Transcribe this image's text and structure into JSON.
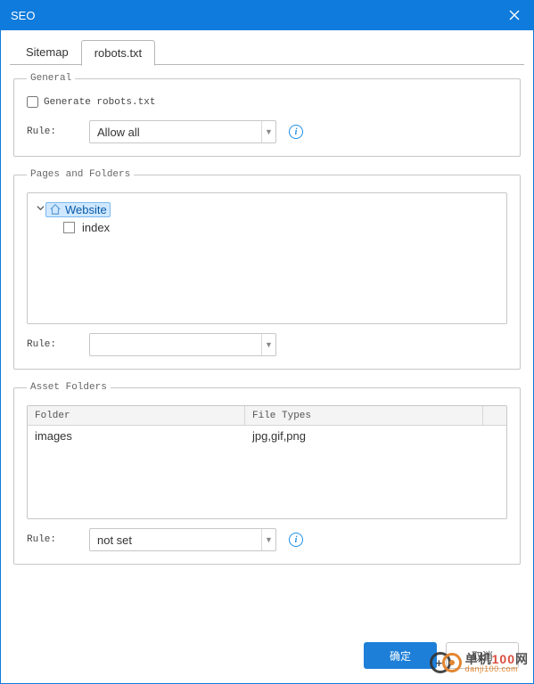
{
  "window": {
    "title": "SEO"
  },
  "tabs": {
    "sitemap": "Sitemap",
    "robots": "robots.txt"
  },
  "general": {
    "legend": "General",
    "generate_label": "Generate robots.txt",
    "generate_checked": false,
    "rule_label": "Rule:",
    "rule_value": "Allow all"
  },
  "pages": {
    "legend": "Pages and Folders",
    "tree": {
      "root": "Website",
      "child": "index"
    },
    "rule_label": "Rule:",
    "rule_value": ""
  },
  "assets": {
    "legend": "Asset Folders",
    "columns": {
      "folder": "Folder",
      "filetypes": "File Types"
    },
    "rows": [
      {
        "folder": "images",
        "filetypes": "jpg,gif,png"
      }
    ],
    "rule_label": "Rule:",
    "rule_value": "not set"
  },
  "footer": {
    "ok": "确定",
    "cancel": "取消"
  },
  "watermark": {
    "main_a": "单机",
    "main_b": "100",
    "main_c": "网",
    "sub": "danji100.com"
  }
}
